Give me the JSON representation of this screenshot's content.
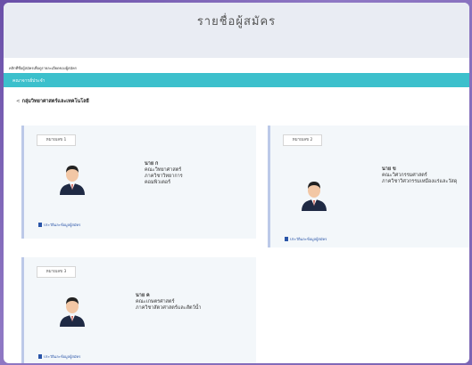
{
  "page": {
    "title": "รายชื่อผู้สมัคร",
    "instruction": "คลิกที่ชื่อผู้สมัครเพื่อดูรายละเอียดของผู้สมัคร",
    "section_label": "คณาจารย์ประจำ",
    "group_label": "กลุ่มวิทยาศาสตร์และเทคโนโลยี",
    "group_icon": "share-icon"
  },
  "candidates": [
    {
      "number": "หมายเลข 1",
      "prefix": "นาย ก",
      "faculty": "คณะวิทยาศาสตร์",
      "department": "ภาควิชาวิทยาการคอมพิวเตอร์",
      "link": "ประวัติและข้อมูลผู้สมัคร"
    },
    {
      "number": "หมายเลข 2",
      "prefix": "นาย ข",
      "faculty": "คณะวิศวกรรมศาสตร์",
      "department": "ภาควิชาวิศวกรรมเหมืองแร่และวัสดุ",
      "link": "ประวัติและข้อมูลผู้สมัคร"
    },
    {
      "number": "หมายเลข 3",
      "prefix": "นาย ค",
      "faculty": "คณะเกษตรศาสตร์",
      "department": "ภาควิชาสัตวศาสตร์และสัตว์น้ำ",
      "link": "ประวัติและข้อมูลผู้สมัคร"
    }
  ],
  "colors": {
    "accent_bar": "#3cc0cc",
    "card_bg": "#f3f7fa",
    "card_border": "#bcc9e8",
    "link": "#2a55a8"
  }
}
